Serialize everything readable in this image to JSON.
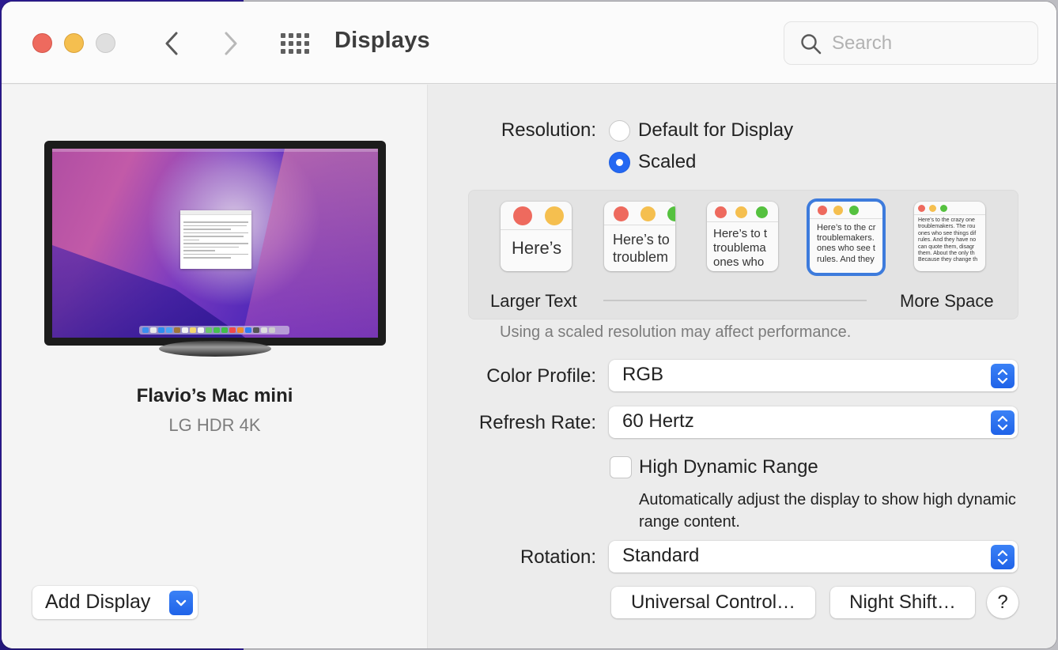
{
  "window": {
    "title": "Displays",
    "search": {
      "placeholder": "Search",
      "value": ""
    }
  },
  "sidebar": {
    "device_name": "Flavio’s Mac mini",
    "device_model": "LG HDR 4K",
    "add_display_label": "Add Display"
  },
  "resolution": {
    "label": "Resolution:",
    "options": [
      {
        "label": "Default for Display",
        "selected": false
      },
      {
        "label": "Scaled",
        "selected": true
      }
    ],
    "scale_left_label": "Larger Text",
    "scale_right_label": "More Space",
    "scale_options": [
      {
        "preview_text": "Here’s",
        "selected": false
      },
      {
        "preview_text": "Here’s to\ntroublem",
        "selected": false
      },
      {
        "preview_text": "Here’s to t\ntroublema\nones who",
        "selected": false
      },
      {
        "preview_text": "Here’s to the cr\ntroublemakers.\nones who see t\nrules. And they",
        "selected": true
      },
      {
        "preview_text": "Here’s to the crazy one\ntroublemakers. The rou\nones who see things dif\nrules. And they have no\ncan quote them, disagr\nthem. About the only th\nBecause they change th",
        "selected": false
      }
    ],
    "selected_scale_index": 3,
    "performance_note": "Using a scaled resolution may affect performance."
  },
  "color_profile": {
    "label": "Color Profile:",
    "value": "RGB"
  },
  "refresh_rate": {
    "label": "Refresh Rate:",
    "value": "60 Hertz"
  },
  "hdr": {
    "label": "High Dynamic Range",
    "checked": false,
    "description": "Automatically adjust the display to show high dynamic range content."
  },
  "rotation": {
    "label": "Rotation:",
    "value": "Standard"
  },
  "buttons": {
    "universal_control": "Universal Control…",
    "night_shift": "Night Shift…",
    "help": "?"
  },
  "colors": {
    "accent": "#2468f2",
    "close": "#ee6a5e",
    "minimize": "#f5bf4f",
    "zoom_disabled": "#dfdfdf",
    "mini_green": "#55c13f"
  }
}
